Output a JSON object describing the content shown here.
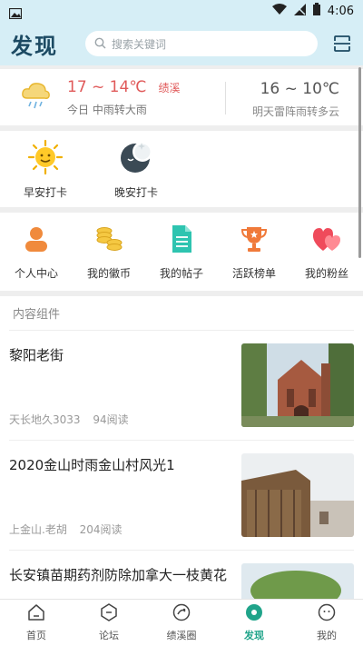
{
  "status_bar": {
    "time": "4:06"
  },
  "header": {
    "title": "发现",
    "search_placeholder": "搜索关键词"
  },
  "weather": {
    "today_temp": "17 ~ 14℃",
    "city": "绩溪",
    "today_desc": "今日 中雨转大雨",
    "tomorrow_temp": "16 ~ 10℃",
    "tomorrow_desc": "明天雷阵雨转多云"
  },
  "checkin": {
    "morning_label": "早安打卡",
    "night_label": "晚安打卡"
  },
  "shortcuts": [
    {
      "label": "个人中心",
      "icon": "person-icon"
    },
    {
      "label": "我的徽币",
      "icon": "coins-icon"
    },
    {
      "label": "我的帖子",
      "icon": "document-icon"
    },
    {
      "label": "活跃榜单",
      "icon": "trophy-icon"
    },
    {
      "label": "我的粉丝",
      "icon": "hearts-icon"
    }
  ],
  "feed": {
    "section_title": "内容组件",
    "posts": [
      {
        "title": "黎阳老街",
        "author": "天长地久3033",
        "views": "94阅读"
      },
      {
        "title": "2020金山时雨金山村风光1",
        "author": "上金山.老胡",
        "views": "204阅读"
      },
      {
        "title": "长安镇苗期药剂防除加拿大一枝黄花",
        "author": "",
        "views": ""
      }
    ]
  },
  "tabbar": [
    {
      "label": "首页",
      "active": false
    },
    {
      "label": "论坛",
      "active": false
    },
    {
      "label": "绩溪圈",
      "active": false
    },
    {
      "label": "发现",
      "active": true
    },
    {
      "label": "我的",
      "active": false
    }
  ],
  "colors": {
    "accent": "#20a48a",
    "header_bg": "#d6eef6",
    "temp_red": "#e05a5a"
  }
}
